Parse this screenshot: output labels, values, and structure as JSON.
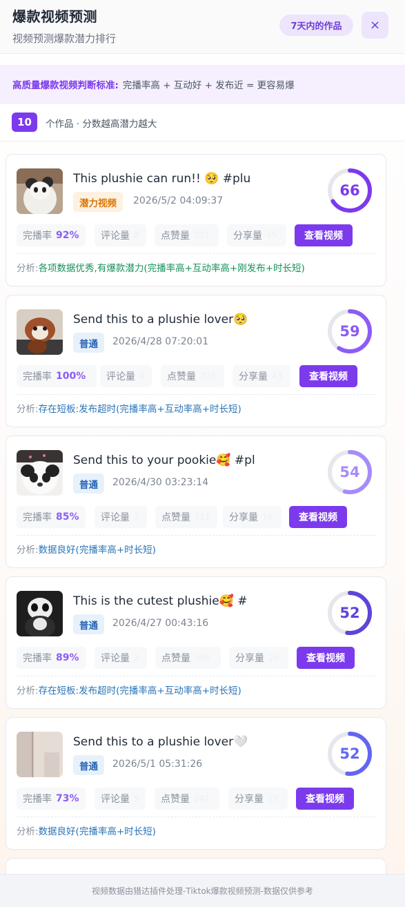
{
  "header": {
    "title": "爆款视频预测",
    "subtitle": "视频预测爆款潜力排行",
    "range_label": "7天内的作品",
    "close_symbol": "×"
  },
  "criteria": {
    "label": "高质量爆款视频判断标准:",
    "text": "完播率高 + 互动好 + 发布近 = 更容易爆"
  },
  "summary": {
    "count": "10",
    "text": "个作品 · 分数越高潜力越大"
  },
  "labels": {
    "completion": "完播率",
    "comments": "评论量",
    "likes": "点赞量",
    "shares": "分享量",
    "view_button": "查看视频",
    "analysis_prefix": "分析:"
  },
  "cards": [
    {
      "title": "This plushie can run!! 🥺 #plu",
      "tag": "潜力视频",
      "tag_type": "potential",
      "time": "2026/5/2 04:09:37",
      "score": 66,
      "score_color": "#7c3aed",
      "completion": "92%",
      "comments_faint": "8",
      "likes_faint": "721",
      "shares_faint": "45",
      "analysis": "各项数据优秀,有爆款潜力(完播率高+互动率高+刚发布+时长短)",
      "analysis_color": "green",
      "thumb": "panda-white"
    },
    {
      "title": "Send this to a plushie lover🥺",
      "tag": "普通",
      "tag_type": "normal",
      "time": "2026/4/28 07:20:01",
      "score": 59,
      "score_color": "#8b5cf6",
      "completion": "100%",
      "comments_faint": "4",
      "likes_faint": "375",
      "shares_faint": "43",
      "analysis": "存在短板:发布超时(完播率高+互动率高+时长短)",
      "analysis_color": "blue",
      "thumb": "red-panda"
    },
    {
      "title": "Send this to your pookie🥰 #pl",
      "tag": "普通",
      "tag_type": "normal",
      "time": "2026/4/30 03:23:14",
      "score": 54,
      "score_color": "#a78bfa",
      "completion": "85%",
      "comments_faint": "7",
      "likes_faint": "311",
      "shares_faint": "16",
      "analysis": "数据良好(完播率高+时长短)",
      "analysis_color": "blue",
      "thumb": "panda-pink"
    },
    {
      "title": "This is the cutest plushie🥰 #",
      "tag": "普通",
      "tag_type": "normal",
      "time": "2026/4/27 00:43:16",
      "score": 52,
      "score_color": "#5b46d8",
      "completion": "89%",
      "comments_faint": "3",
      "likes_faint": "395",
      "shares_faint": "26",
      "analysis": "存在短板:发布超时(完播率高+互动率高+时长短)",
      "analysis_color": "blue",
      "thumb": "panda-dark"
    },
    {
      "title": "Send this to a plushie lover🤍",
      "tag": "普通",
      "tag_type": "normal",
      "time": "2026/5/1 05:31:26",
      "score": 52,
      "score_color": "#6366f1",
      "completion": "73%",
      "comments_faint": "5",
      "likes_faint": "242",
      "shares_faint": "23",
      "analysis": "数据良好(完播率高+时长短)",
      "analysis_color": "blue",
      "thumb": "room"
    }
  ],
  "footer": {
    "text": "视频数据由猎达插件处理-Tiktok爆款视频预测-数据仅供参考"
  }
}
